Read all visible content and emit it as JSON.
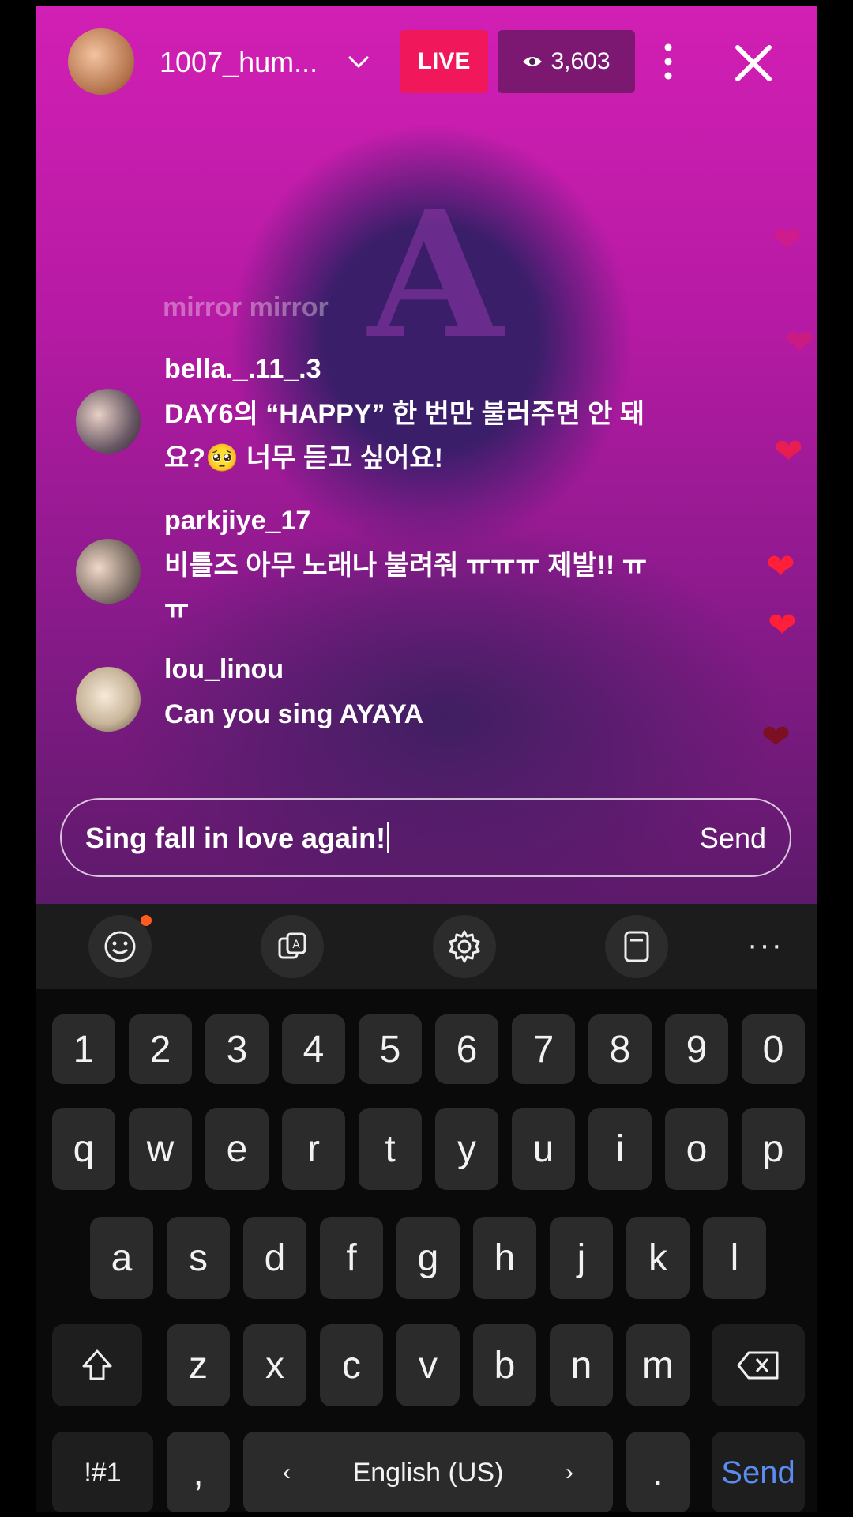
{
  "header": {
    "host_name": "1007_hum...",
    "live_label": "LIVE",
    "viewer_count": "3,603"
  },
  "comments": {
    "faded": "mirror mirror",
    "items": [
      {
        "user": "bella._.11_.3",
        "text": "DAY6의 “HAPPY” 한 번만 불러주면 안 돼요?🥺 너무 듣고 싶어요!"
      },
      {
        "user": "parkjiye_17",
        "text": "비틀즈 아무 노래나 불려줘 ㅠㅠㅠ 제발!! ㅠㅠ"
      },
      {
        "user": "lou_linou",
        "text": "Can you sing AYAYA"
      }
    ]
  },
  "input": {
    "value": "Sing fall in love again!",
    "send_label": "Send"
  },
  "keyboard": {
    "numbers": [
      "1",
      "2",
      "3",
      "4",
      "5",
      "6",
      "7",
      "8",
      "9",
      "0"
    ],
    "row1": [
      "q",
      "w",
      "e",
      "r",
      "t",
      "y",
      "u",
      "i",
      "o",
      "p"
    ],
    "row2": [
      "a",
      "s",
      "d",
      "f",
      "g",
      "h",
      "j",
      "k",
      "l"
    ],
    "row3": [
      "z",
      "x",
      "c",
      "v",
      "b",
      "n",
      "m"
    ],
    "symbols_label": "!#1",
    "comma": ",",
    "language": "English (US)",
    "period": ".",
    "send_label": "Send",
    "toolbar_more": "···"
  },
  "colors": {
    "live": "#f0185a",
    "send_key": "#5b8cf0",
    "heart": "#ff1f3a"
  }
}
